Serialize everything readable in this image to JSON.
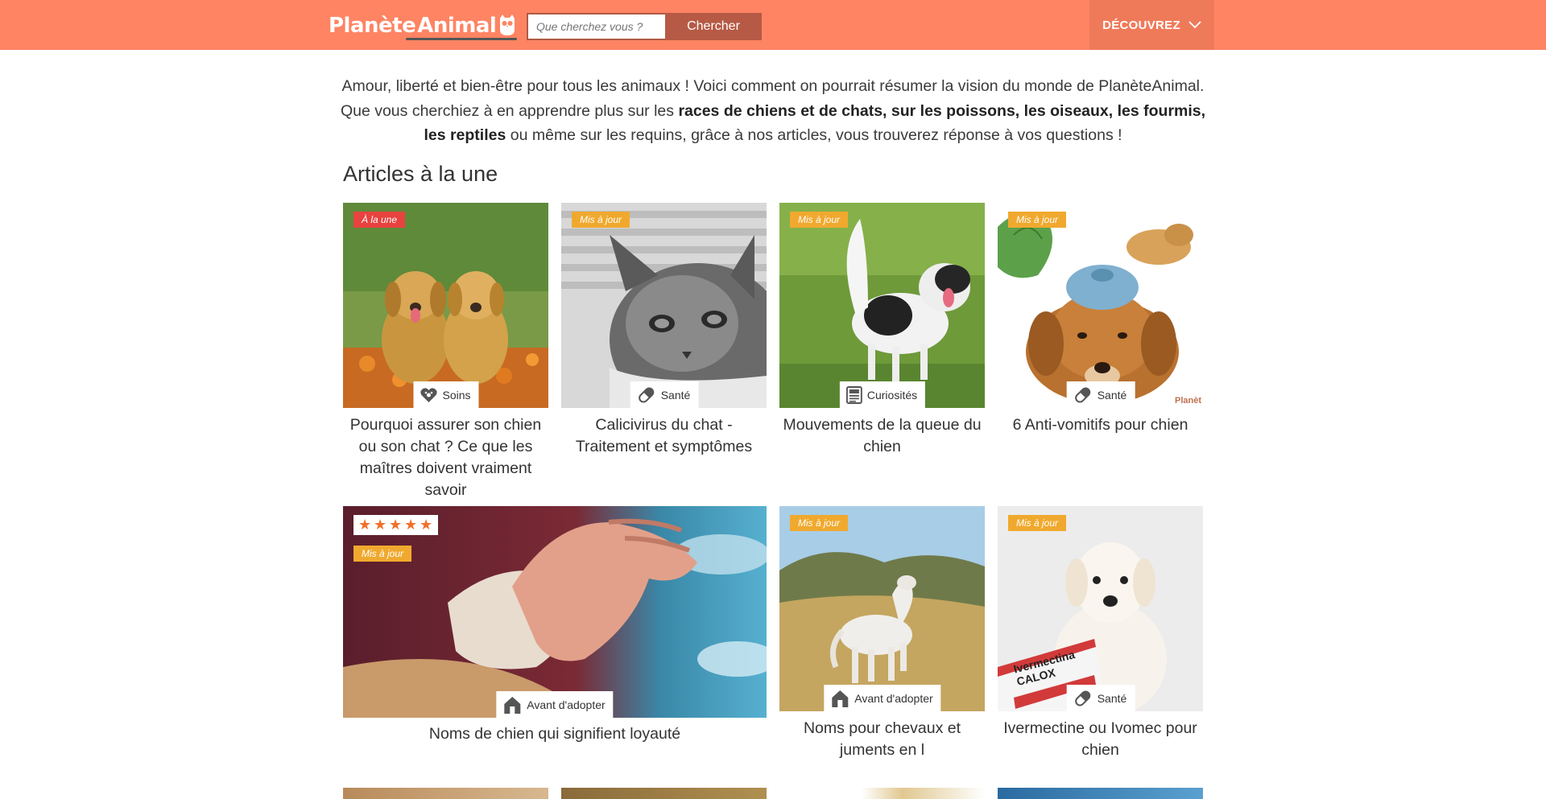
{
  "header": {
    "logo_part1": "Planète",
    "logo_part2": "Animal",
    "search_placeholder": "Que cherchez vous ?",
    "search_button": "Chercher",
    "discover_label": "DÉCOUVREZ",
    "bar_color": "#fe8463"
  },
  "intro": {
    "part1": "Amour, liberté et bien-être pour tous les animaux ! Voici comment on pourrait résumer la vision du monde de PlanèteAnimal. Que vous cherchiez à en apprendre plus sur les ",
    "bold": "races de chiens et de chats, sur les poissons, les oiseaux, les fourmis, les reptiles",
    "part2": " ou même sur les requins, grâce à nos articles, vous trouverez réponse à vos questions !"
  },
  "section_title": "Articles à la une",
  "articles": [
    {
      "badge": "À la une",
      "category": "Soins",
      "category_icon": "heart-paw-icon",
      "title": "Pourquoi assurer son chien ou son chat ? Ce que les maîtres doivent vraiment savoir"
    },
    {
      "badge": "Mis à jour",
      "category": "Santé",
      "category_icon": "pill-icon",
      "title": "Calicivirus du chat - Traitement et symptômes"
    },
    {
      "badge": "Mis à jour",
      "category": "Curiosités",
      "category_icon": "newspaper-icon",
      "title": "Mouvements de la queue du chien"
    },
    {
      "badge": "Mis à jour",
      "category": "Santé",
      "category_icon": "pill-icon",
      "title": "6 Anti-vomitifs pour chien",
      "watermark": "Planèt"
    },
    {
      "badge": "Mis à jour",
      "rating": 5,
      "category": "Avant d'adopter",
      "category_icon": "house-icon",
      "title": "Noms de chien qui signifient loyauté"
    },
    {
      "badge": "Mis à jour",
      "category": "Avant d'adopter",
      "category_icon": "house-icon",
      "title": "Noms pour chevaux et juments en l"
    },
    {
      "badge": "Mis à jour",
      "category": "Santé",
      "category_icon": "pill-icon",
      "title": "Ivermectine ou Ivomec pour chien",
      "product_text": "Ivermectina CALOX"
    }
  ]
}
